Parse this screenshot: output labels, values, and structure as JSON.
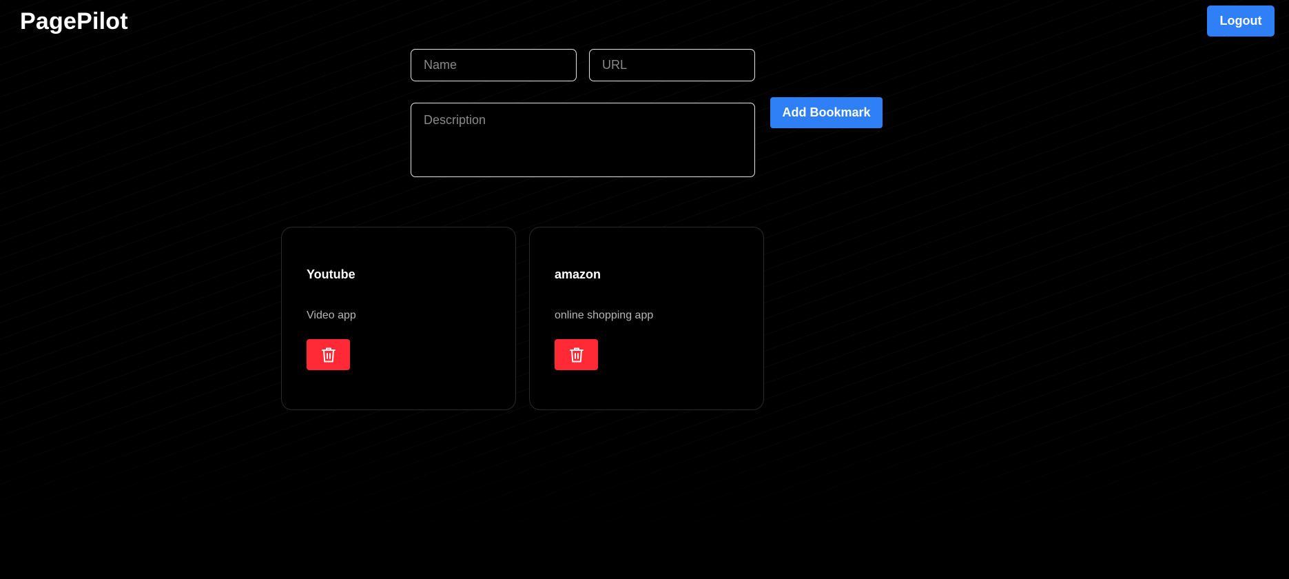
{
  "app": {
    "brand": "PagePilot",
    "logout_label": "Logout"
  },
  "form": {
    "name": {
      "value": "",
      "placeholder": "Name"
    },
    "url": {
      "value": "",
      "placeholder": "URL"
    },
    "description": {
      "value": "",
      "placeholder": "Description"
    },
    "add_label": "Add Bookmark"
  },
  "bookmarks": [
    {
      "name": "Youtube",
      "description": "Video app",
      "delete_icon": "trash-icon"
    },
    {
      "name": "amazon",
      "description": "online shopping app",
      "delete_icon": "trash-icon"
    }
  ],
  "colors": {
    "background": "#000000",
    "primary": "#2f80f6",
    "danger": "#ff2a35",
    "text": "#ffffff",
    "muted_text": "#b8b8b8"
  }
}
